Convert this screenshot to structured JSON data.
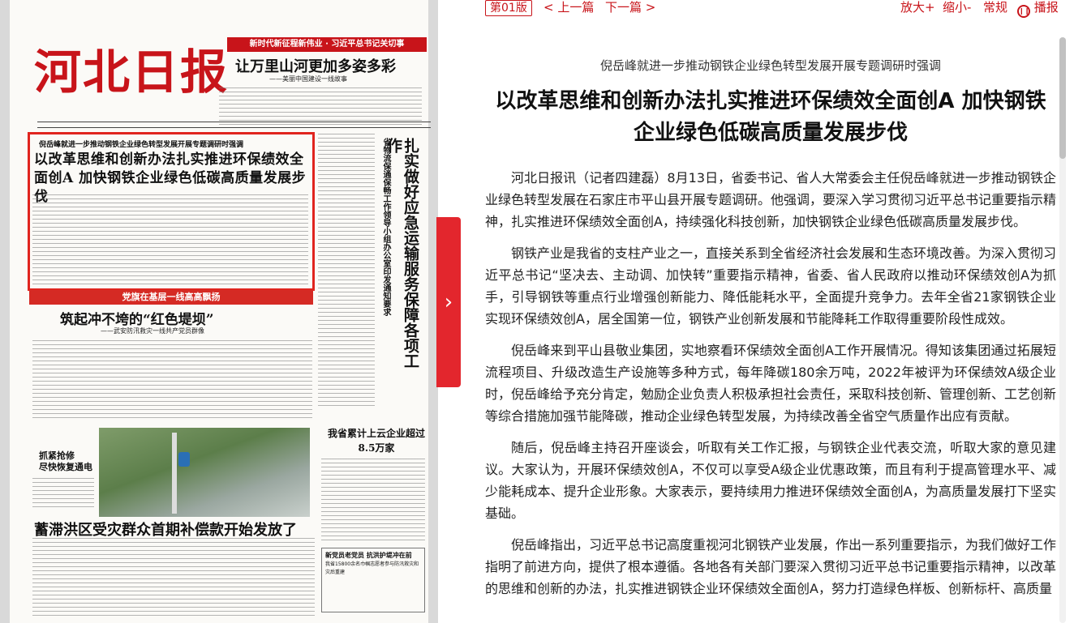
{
  "toolbar": {
    "page_label": "第01版",
    "prev_link": "< 上一篇",
    "next_link": "下一篇 >",
    "zoom_in": "放大+",
    "zoom_out": "缩小-",
    "normal": "常规",
    "play": "播报"
  },
  "newspaper": {
    "masthead": "河北日报",
    "banner": "新时代新征程新伟业 · 习近平总书记关切事",
    "feature_headline": "让万里山河更加多姿多彩",
    "feature_sub": "——美丽中国建设一线故事",
    "lead_kicker": "倪岳峰就进一步推动钢铁企业绿色转型发展开展专题调研时强调",
    "lead_title": "以改革思维和创新办法扎实推进环保绩效全面创A 加快钢铁企业绿色低碳高质量发展步伐",
    "vertical_kicker": "省物流保通保畅工作领导小组办公室印发通知要求",
    "vertical_title": "扎实做好应急运输服务保障各项工作",
    "party_banner": "党旗在基层一线高高飘扬",
    "dike_title": "筑起冲不垮的“红色堤坝”",
    "dike_sub": "——武安防汛救灾一线共产党员群像",
    "photo_caption": "抓紧抢修\n尽快恢复通电",
    "enterprise_title": "我省累计上云企业超过8.5万家",
    "flood_title": "蓄滞洪区受灾群众首期补偿款开始发放了",
    "small_box_title": "新党员老党员 抗洪护堤冲在前",
    "small_box_sub": "我省15800余名巾帼志愿者参与防汛救灾和灾后重建"
  },
  "article": {
    "kicker": "倪岳峰就进一步推动钢铁企业绿色转型发展开展专题调研时强调",
    "title": "以改革思维和创新办法扎实推进环保绩效全面创A 加快钢铁企业绿色低碳高质量发展步伐",
    "paragraphs": [
      "河北日报讯（记者四建磊）8月13日，省委书记、省人大常委会主任倪岳峰就进一步推动钢铁企业绿色转型发展在石家庄市平山县开展专题调研。他强调，要深入学习贯彻习近平总书记重要指示精神，扎实推进环保绩效全面创A，持续强化科技创新，加快钢铁企业绿色低碳高质量发展步伐。",
      "钢铁产业是我省的支柱产业之一，直接关系到全省经济社会发展和生态环境改善。为深入贯彻习近平总书记“坚决去、主动调、加快转”重要指示精神，省委、省人民政府以推动环保绩效创A为抓手，引导钢铁等重点行业增强创新能力、降低能耗水平，全面提升竞争力。去年全省21家钢铁企业实现环保绩效创A，居全国第一位，钢铁产业创新发展和节能降耗工作取得重要阶段性成效。",
      "倪岳峰来到平山县敬业集团，实地察看环保绩效全面创A工作开展情况。得知该集团通过拓展短流程项目、升级改造生产设施等多种方式，每年降碳180余万吨，2022年被评为环保绩效A级企业时，倪岳峰给予充分肯定，勉励企业负责人积极承担社会责任，采取科技创新、管理创新、工艺创新等综合措施加强节能降碳，推动企业绿色转型发展，为持续改善全省空气质量作出应有贡献。",
      "随后，倪岳峰主持召开座谈会，听取有关工作汇报，与钢铁企业代表交流，听取大家的意见建议。大家认为，开展环保绩效创A，不仅可以享受A级企业优惠政策，而且有利于提高管理水平、减少能耗成本、提升企业形象。大家表示，要持续用力推进环保绩效全面创A，为高质量发展打下坚实基础。",
      "倪岳峰指出，习近平总书记高度重视河北钢铁产业发展，作出一系列重要指示，为我们做好工作指明了前进方向，提供了根本遵循。各地各有关部门要深入贯彻习近平总书记重要指示精神，以改革的思维和创新的办法，扎实推进钢铁企业环保绩效全面创A，努力打造绿色样板、创新标杆、高质量"
    ]
  },
  "colors": {
    "brand_red": "#c8141a",
    "arrow_red": "#e3262d"
  }
}
